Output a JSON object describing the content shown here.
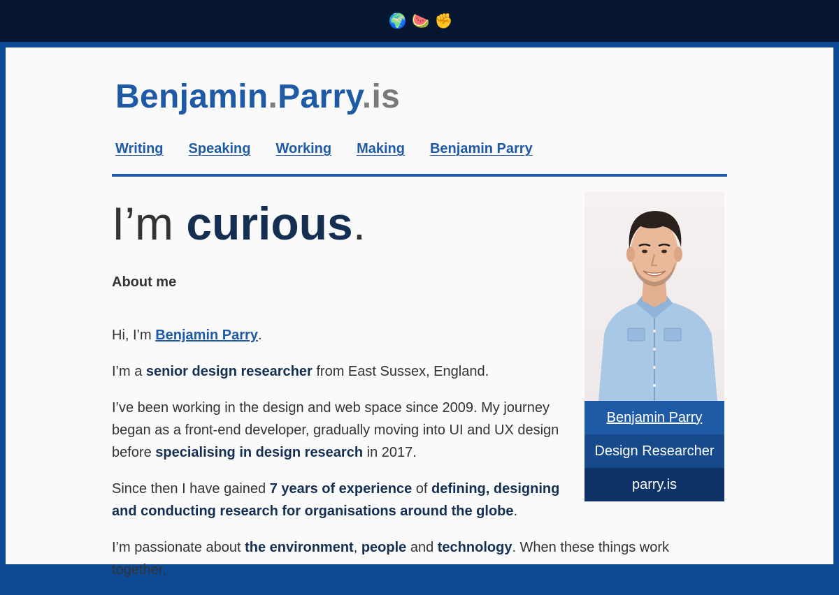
{
  "topbar": {
    "emojis": [
      "🌍",
      "🍉",
      "✊"
    ]
  },
  "site_title": {
    "name1": "Benjamin",
    "dot1": ".",
    "name2": "Parry",
    "dot2": ".",
    "tld": "is"
  },
  "nav": [
    "Writing",
    "Speaking",
    "Working",
    "Making",
    "Benjamin Parry"
  ],
  "headline": {
    "prefix": "I’m ",
    "word": "curious",
    "suffix": "."
  },
  "about_heading": "About me",
  "paragraphs": {
    "p1": {
      "a": "Hi, I’m ",
      "link": "Benjamin Parry",
      "b": "."
    },
    "p2": {
      "a": "I’m a ",
      "strong": "senior design researcher",
      "b": " from East Sussex, England."
    },
    "p3": {
      "a": "I’ve been working in the design and web space since 2009. My journey began as a front-end developer, gradually moving into UI and UX design before ",
      "strong": "specialising in design research",
      "b": " in 2017."
    },
    "p4": {
      "a": "Since then I have gained ",
      "s1": "7 years of experience",
      "b": " of ",
      "s2": "defining, designing and conducting research for organisations around the globe",
      "c": "."
    },
    "p5": {
      "a": "I’m passionate about ",
      "s1": "the environment",
      "b": ", ",
      "s2": "people",
      "c": " and ",
      "s3": "technology",
      "d": ". When these things work together,"
    }
  },
  "card": {
    "name": "Benjamin Parry",
    "role": "Design Researcher",
    "site": "parry.is"
  },
  "colors": {
    "accent": "#1f5aa6",
    "dark_navy": "#071630",
    "frame_blue": "#0d4a96"
  }
}
